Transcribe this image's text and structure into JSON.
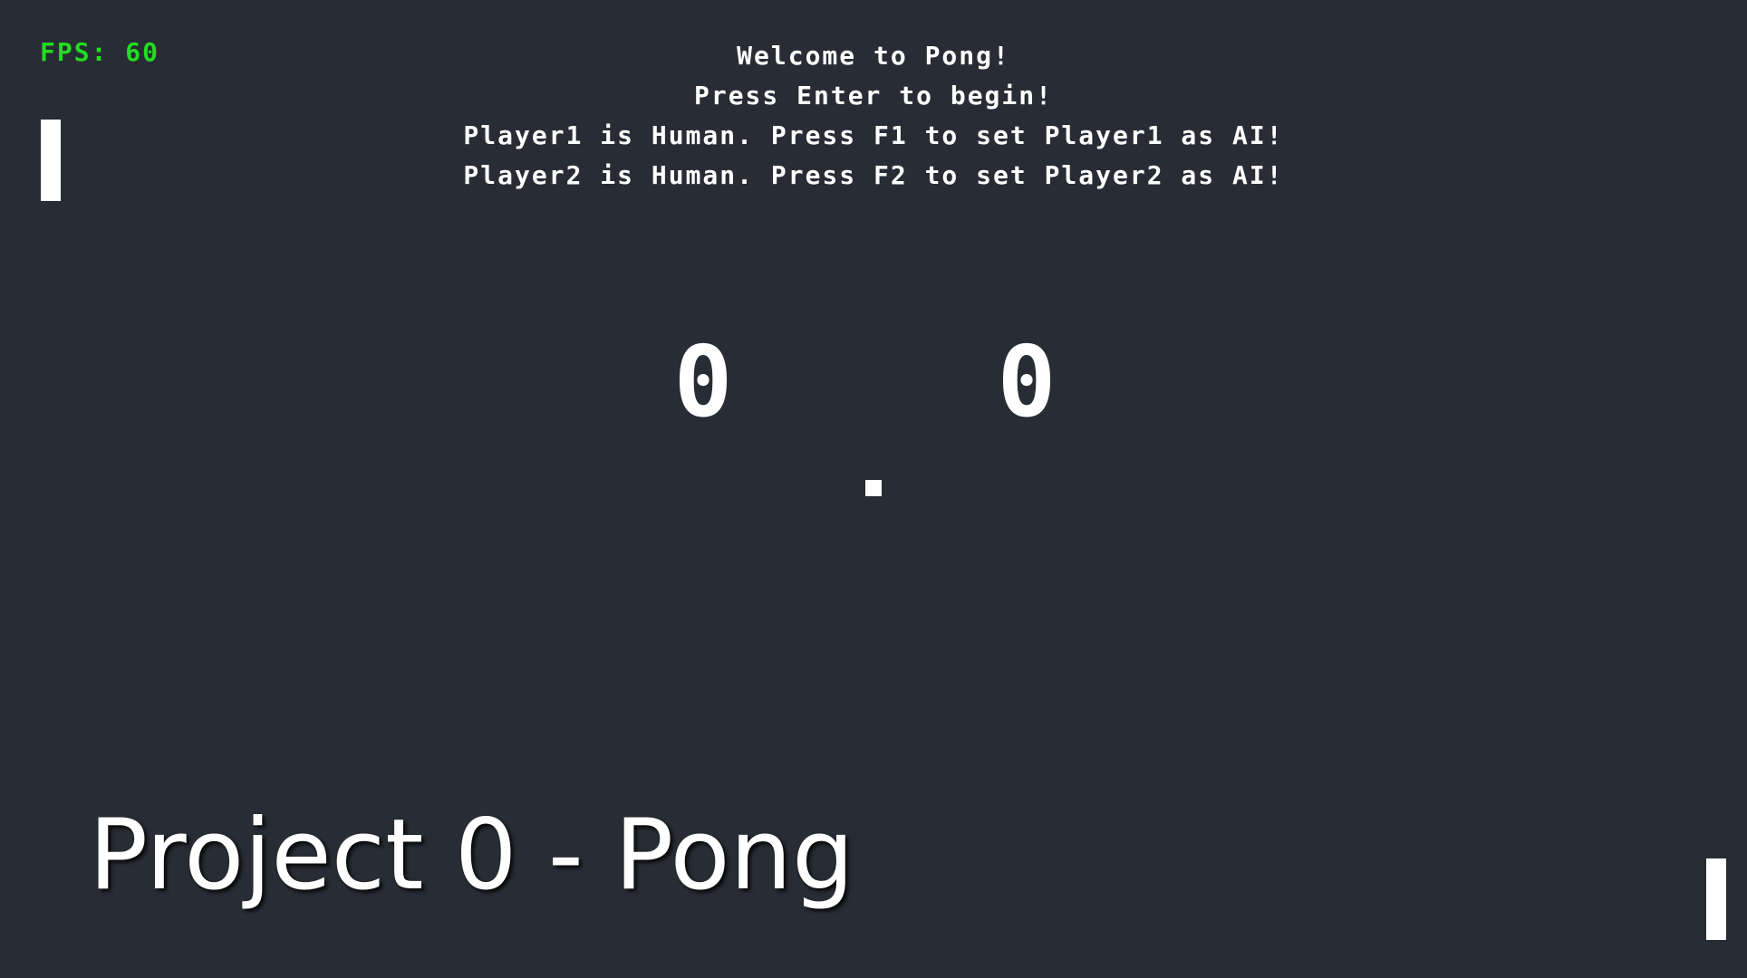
{
  "hud": {
    "fps_label": "FPS: 60",
    "fps_color": "#22dd22"
  },
  "messages": {
    "welcome": "Welcome to Pong!",
    "start_prompt": "Press Enter to begin!",
    "player1_status": "Player1 is Human. Press F1 to set Player1 as AI!",
    "player2_status": "Player2 is Human. Press F2 to set Player2 as AI!"
  },
  "score": {
    "player1": "0",
    "player2": "0"
  },
  "caption": {
    "text": "Project 0 - Pong"
  },
  "colors": {
    "background": "#282c34",
    "foreground": "#ffffff"
  }
}
